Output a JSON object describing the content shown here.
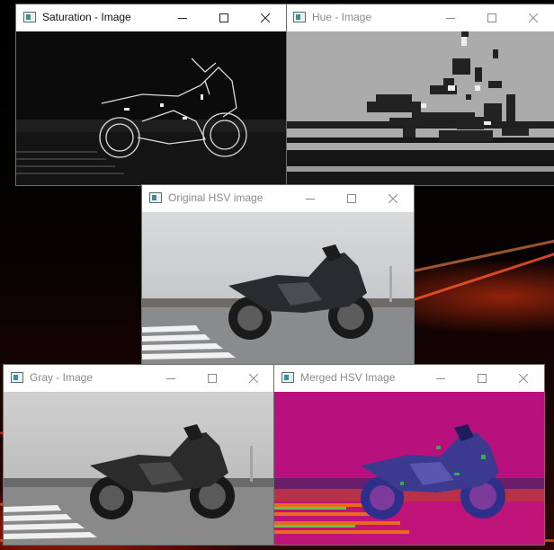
{
  "windows": [
    {
      "id": "saturation",
      "title": "Saturation - Image",
      "active": true
    },
    {
      "id": "hue",
      "title": "Hue - Image",
      "active": false
    },
    {
      "id": "original",
      "title": "Original HSV image",
      "active": false
    },
    {
      "id": "gray",
      "title": "Gray - Image",
      "active": false
    },
    {
      "id": "merged",
      "title": "Merged HSV Image",
      "active": false
    }
  ],
  "icons": {
    "app": "opencv-window-icon",
    "minimize": "minimize-icon",
    "maximize": "maximize-icon",
    "close": "close-icon"
  },
  "colors": {
    "titlebar_active_text": "#111111",
    "titlebar_inactive_text": "#8a8a8a",
    "merged_magenta": "#c0137a"
  }
}
